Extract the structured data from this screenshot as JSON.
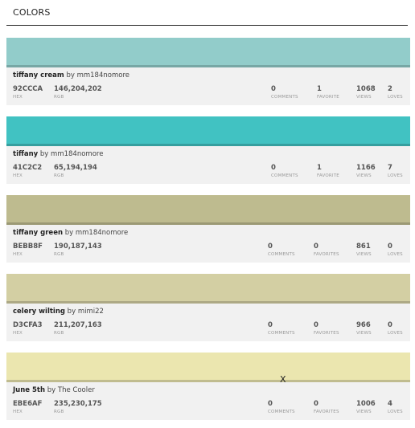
{
  "header": {
    "title": "COLORS"
  },
  "colors": [
    {
      "name": "tiffany cream",
      "by_prefix": "by",
      "author": "mm184nomore",
      "swatch": "#92CCCA",
      "hex": "92CCCA",
      "hex_label": "HEX",
      "rgb": "146,204,202",
      "rgb_label": "RGB",
      "comments": "0",
      "comments_label": "COMMENTS",
      "favorites": "1",
      "favorites_label": "FAVORITE",
      "views": "1068",
      "views_label": "VIEWS",
      "loves": "2",
      "loves_label": "LOVES"
    },
    {
      "name": "tiffany",
      "by_prefix": "by",
      "author": "mm184nomore",
      "swatch": "#41C2C2",
      "hex": "41C2C2",
      "hex_label": "HEX",
      "rgb": "65,194,194",
      "rgb_label": "RGB",
      "comments": "0",
      "comments_label": "COMMENTS",
      "favorites": "1",
      "favorites_label": "FAVORITE",
      "views": "1166",
      "views_label": "VIEWS",
      "loves": "7",
      "loves_label": "LOVES"
    },
    {
      "name": "tiffany green",
      "by_prefix": "by",
      "author": "mm184nomore",
      "swatch": "#BEBB8F",
      "hex": "BEBB8F",
      "hex_label": "HEX",
      "rgb": "190,187,143",
      "rgb_label": "RGB",
      "comments": "0",
      "comments_label": "COMMENTS",
      "favorites": "0",
      "favorites_label": "FAVORITES",
      "views": "861",
      "views_label": "VIEWS",
      "loves": "0",
      "loves_label": "LOVES"
    },
    {
      "name": "celery wilting",
      "by_prefix": "by",
      "author": "mimi22",
      "swatch": "#D3CFA3",
      "hex": "D3CFA3",
      "hex_label": "HEX",
      "rgb": "211,207,163",
      "rgb_label": "RGB",
      "comments": "0",
      "comments_label": "COMMENTS",
      "favorites": "0",
      "favorites_label": "FAVORITES",
      "views": "966",
      "views_label": "VIEWS",
      "loves": "0",
      "loves_label": "LOVES"
    },
    {
      "name": "June 5th",
      "by_prefix": "by",
      "author": "The Cooler",
      "swatch": "#EBE6AF",
      "hex": "EBE6AF",
      "hex_label": "HEX",
      "rgb": "235,230,175",
      "rgb_label": "RGB",
      "comments": "0",
      "comments_label": "COMMENTS",
      "favorites": "0",
      "favorites_label": "FAVORITES",
      "views": "1006",
      "views_label": "VIEWS",
      "loves": "4",
      "loves_label": "LOVES"
    }
  ],
  "cursor_glyph": "X"
}
